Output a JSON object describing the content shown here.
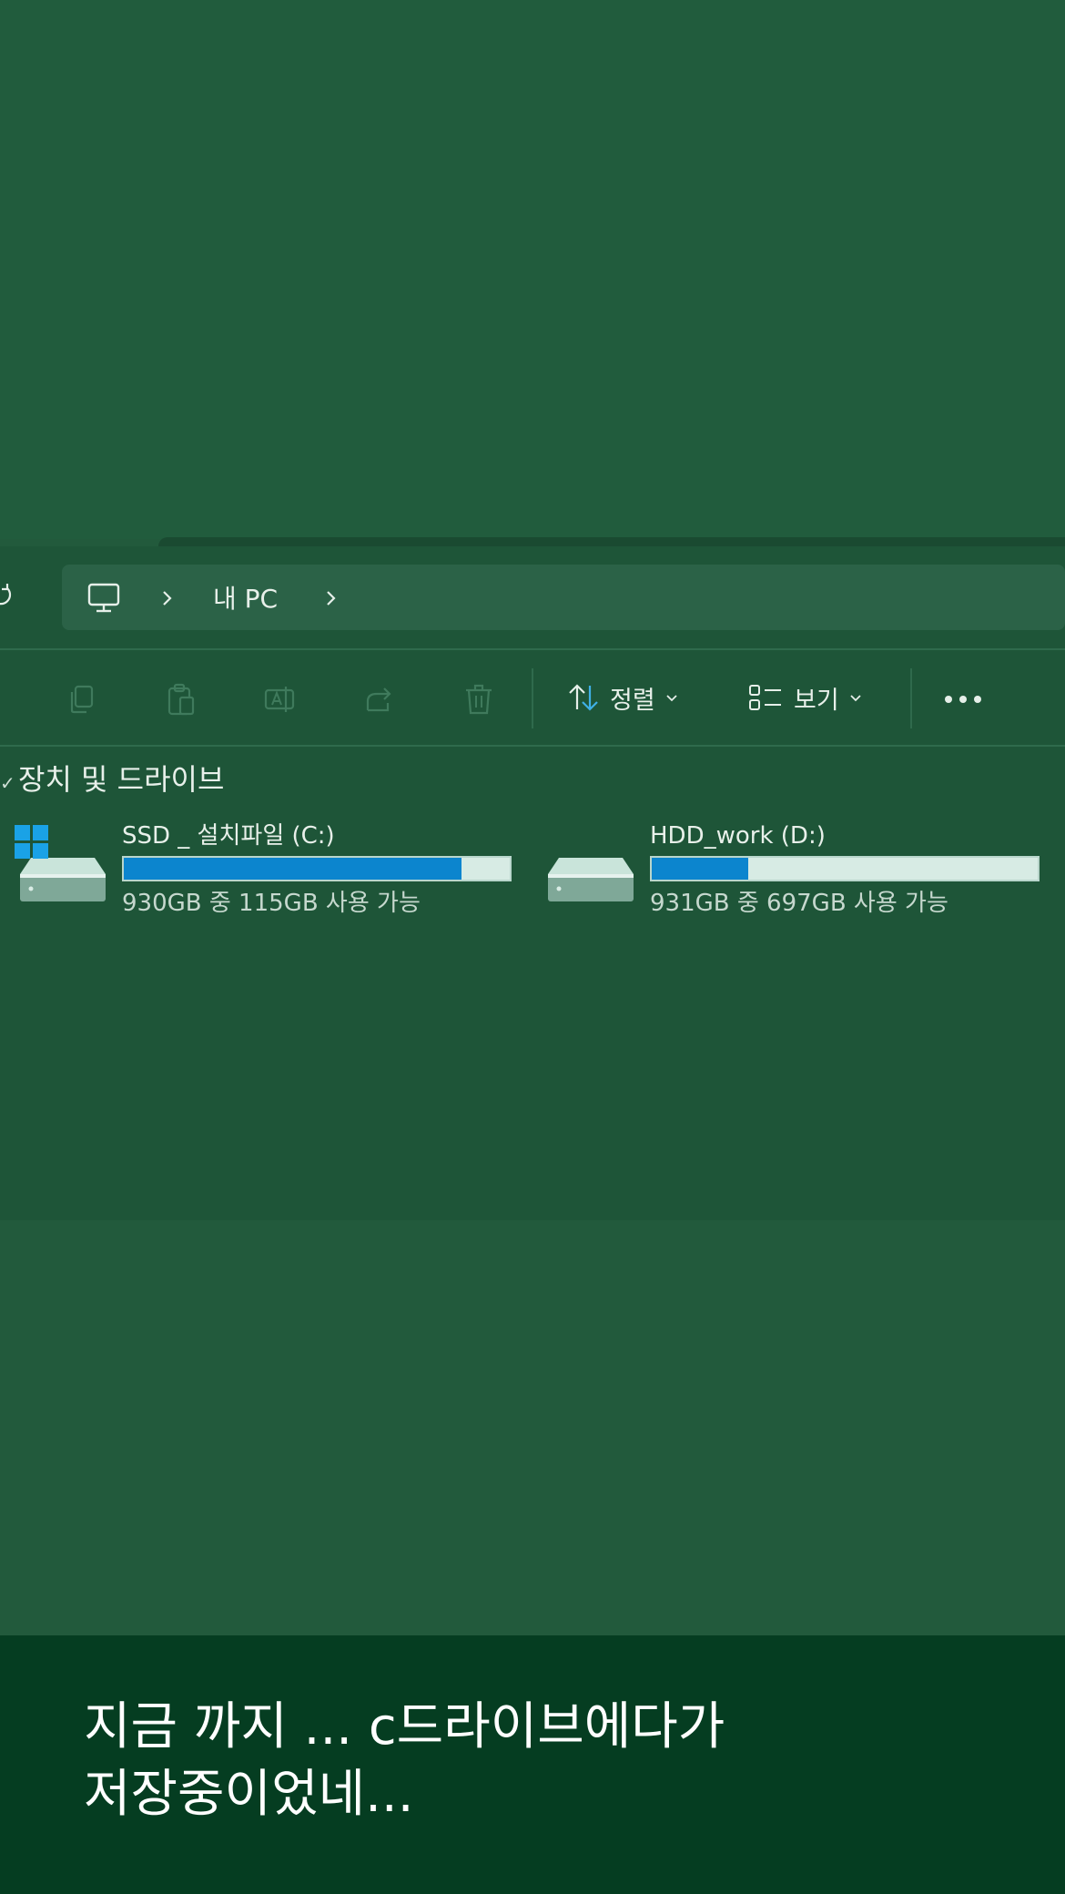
{
  "breadcrumb": {
    "items": [
      "내 PC"
    ]
  },
  "toolbar": {
    "sort_label": "정렬",
    "view_label": "보기"
  },
  "section": {
    "title": "장치 및 드라이브"
  },
  "drives": [
    {
      "name": "SSD _ 설치파일 (C:)",
      "free_text": "930GB 중 115GB 사용 가능",
      "used_fraction": 0.876
    },
    {
      "name": "HDD_work (D:)",
      "free_text": "931GB 중 697GB 사용 가능",
      "used_fraction": 0.251
    }
  ],
  "caption": {
    "line1": "지금 까지 ... c드라이브에다가",
    "line2": "저장중이었네..."
  },
  "colors": {
    "accent": "#0c85ce",
    "background": "#225a3c",
    "caption_bg": "#053d21"
  }
}
